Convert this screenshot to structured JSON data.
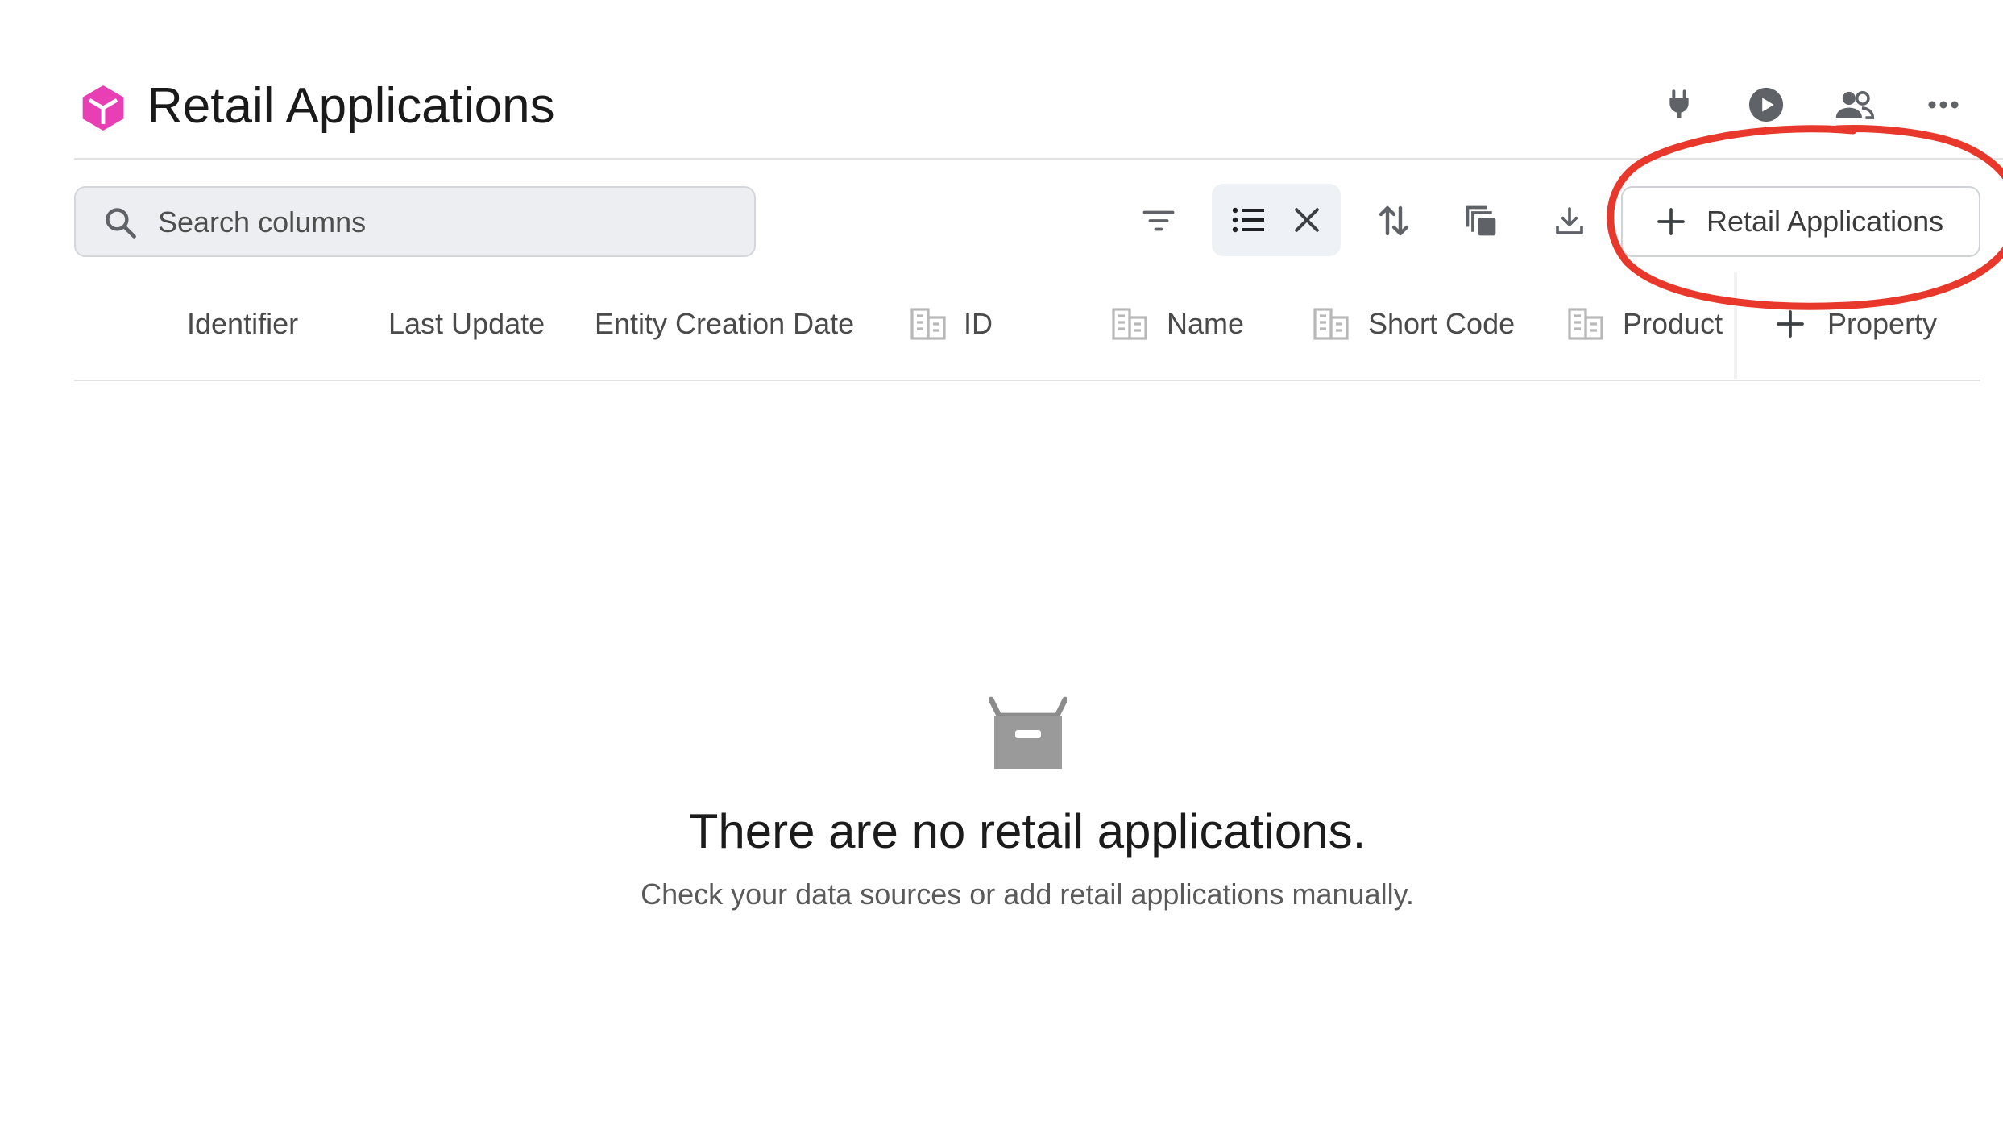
{
  "header": {
    "title": "Retail Applications",
    "logo_icon": "cube-icon",
    "logo_color": "#e83fb5",
    "actions": [
      {
        "name": "plug-icon"
      },
      {
        "name": "play-circle-icon"
      },
      {
        "name": "people-icon"
      },
      {
        "name": "more-horizontal-icon"
      }
    ]
  },
  "toolbar": {
    "search_placeholder": "Search columns",
    "search_value": "",
    "tools": [
      "filter-icon",
      "list-view-icon",
      "close-icon",
      "sort-icon",
      "copy-icon",
      "download-icon"
    ],
    "add_button_label": "Retail Applications"
  },
  "columns": [
    {
      "label": "Identifier",
      "icon": null
    },
    {
      "label": "Last Update",
      "icon": null
    },
    {
      "label": "Entity Creation Date",
      "icon": null
    },
    {
      "label": "ID",
      "icon": "building-icon"
    },
    {
      "label": "Name",
      "icon": "building-icon"
    },
    {
      "label": "Short Code",
      "icon": "building-icon"
    },
    {
      "label": "Product",
      "icon": "building-icon"
    }
  ],
  "add_property_label": "Property",
  "empty_state": {
    "icon": "inbox-box-icon",
    "title": "There are no retail applications.",
    "subtitle": "Check your data sources or add retail applications manually."
  },
  "colors": {
    "accent": "#e83fb5",
    "annotation": "#e8382b",
    "icon_gray": "#5f6368",
    "divider": "#e2e2e2"
  }
}
